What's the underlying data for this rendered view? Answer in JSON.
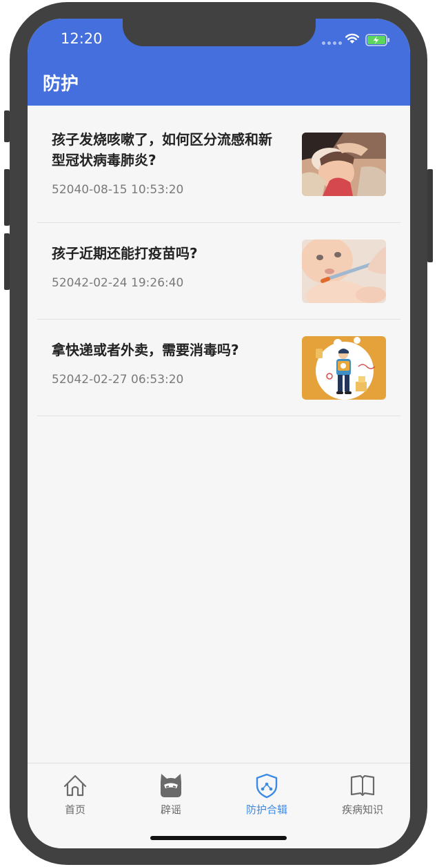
{
  "status_bar": {
    "time": "12:20"
  },
  "nav": {
    "title": "防护"
  },
  "articles": [
    {
      "title": "孩子发烧咳嗽了，如何区分流感和新型冠状病毒肺炎?",
      "date": "52040-08-15 10:53:20",
      "thumb_icon": "sick-child-thumbnail"
    },
    {
      "title": "孩子近期还能打疫苗吗?",
      "date": "52042-02-24 19:26:40",
      "thumb_icon": "baby-vaccine-thumbnail"
    },
    {
      "title": "拿快递或者外卖，需要消毒吗?",
      "date": "52042-02-27 06:53:20",
      "thumb_icon": "delivery-thumbnail"
    }
  ],
  "tabs": [
    {
      "label": "首页",
      "icon": "home-icon",
      "active": false
    },
    {
      "label": "辟谣",
      "icon": "mask-face-icon",
      "active": false
    },
    {
      "label": "防护合辑",
      "icon": "shield-icon",
      "active": true
    },
    {
      "label": "疾病知识",
      "icon": "book-icon",
      "active": false
    }
  ],
  "colors": {
    "primary": "#456fdc",
    "active_tab": "#3d8ae6",
    "background": "#f6f6f6",
    "frame": "#414141"
  }
}
